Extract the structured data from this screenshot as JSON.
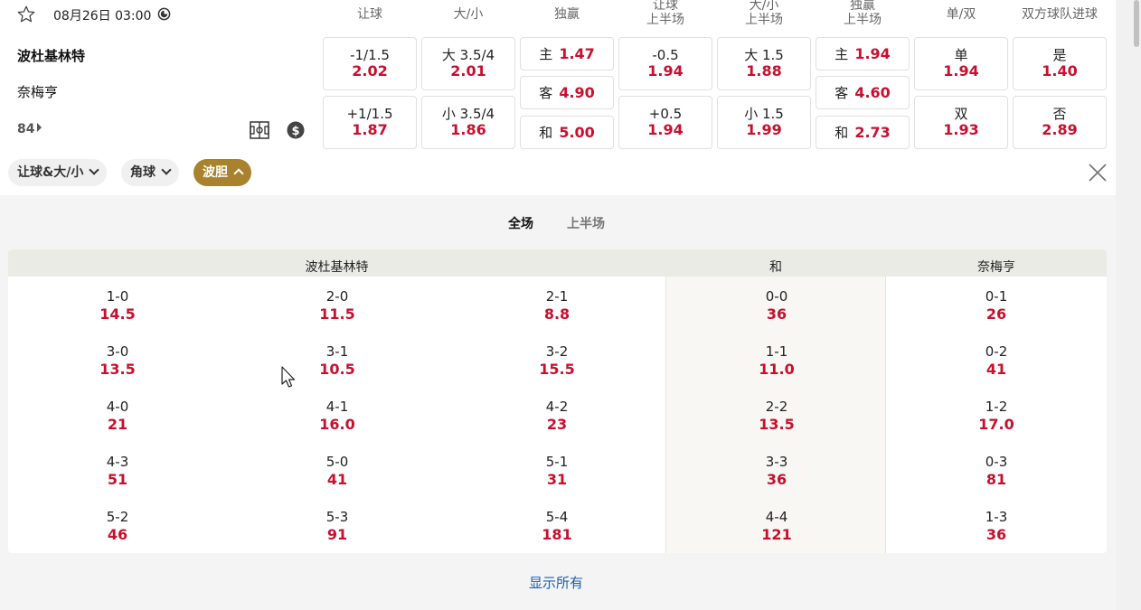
{
  "match": {
    "datetime": "08月26日 03:00",
    "home": "波杜基林特",
    "away": "奈梅亨",
    "more_markets": "84"
  },
  "headers": [
    {
      "l1": "让球",
      "l2": ""
    },
    {
      "l1": "大/小",
      "l2": ""
    },
    {
      "l1": "独赢",
      "l2": ""
    },
    {
      "l1": "让球",
      "l2": "上半场"
    },
    {
      "l1": "大/小",
      "l2": "上半场"
    },
    {
      "l1": "独赢",
      "l2": "上半场"
    },
    {
      "l1": "单/双",
      "l2": ""
    },
    {
      "l1": "双方球队进球",
      "l2": ""
    }
  ],
  "odds": {
    "handicap": [
      {
        "label": "-1/1.5",
        "odd": "2.02"
      },
      {
        "label": "+1/1.5",
        "odd": "1.87"
      }
    ],
    "over_under": [
      {
        "label": "大 3.5/4",
        "odd": "2.01"
      },
      {
        "label": "小 3.5/4",
        "odd": "1.86"
      }
    ],
    "moneyline": [
      {
        "label": "主",
        "odd": "1.47"
      },
      {
        "label": "客",
        "odd": "4.90"
      },
      {
        "label": "和",
        "odd": "5.00"
      }
    ],
    "handicap_1h": [
      {
        "label": "-0.5",
        "odd": "1.94"
      },
      {
        "label": "+0.5",
        "odd": "1.94"
      }
    ],
    "over_under_1h": [
      {
        "label": "大 1.5",
        "odd": "1.88"
      },
      {
        "label": "小 1.5",
        "odd": "1.99"
      }
    ],
    "moneyline_1h": [
      {
        "label": "主",
        "odd": "1.94"
      },
      {
        "label": "客",
        "odd": "4.60"
      },
      {
        "label": "和",
        "odd": "2.73"
      }
    ],
    "odd_even": [
      {
        "label": "单",
        "odd": "1.94"
      },
      {
        "label": "双",
        "odd": "1.93"
      }
    ],
    "btts": [
      {
        "label": "是",
        "odd": "1.40"
      },
      {
        "label": "否",
        "odd": "2.89"
      }
    ]
  },
  "filters": {
    "chip1": "让球&大/小",
    "chip2": "角球",
    "chip3": "波胆"
  },
  "panel_tabs": {
    "full": "全场",
    "half": "上半场"
  },
  "grid_headers": {
    "home": "波杜基林特",
    "draw": "和",
    "away": "奈梅亨"
  },
  "correct_score": {
    "home_c1": [
      {
        "s": "1-0",
        "o": "14.5"
      },
      {
        "s": "3-0",
        "o": "13.5"
      },
      {
        "s": "4-0",
        "o": "21"
      },
      {
        "s": "4-3",
        "o": "51"
      },
      {
        "s": "5-2",
        "o": "46"
      }
    ],
    "home_c2": [
      {
        "s": "2-0",
        "o": "11.5"
      },
      {
        "s": "3-1",
        "o": "10.5"
      },
      {
        "s": "4-1",
        "o": "16.0"
      },
      {
        "s": "5-0",
        "o": "41"
      },
      {
        "s": "5-3",
        "o": "91"
      }
    ],
    "home_c3": [
      {
        "s": "2-1",
        "o": "8.8"
      },
      {
        "s": "3-2",
        "o": "15.5"
      },
      {
        "s": "4-2",
        "o": "23"
      },
      {
        "s": "5-1",
        "o": "31"
      },
      {
        "s": "5-4",
        "o": "181"
      }
    ],
    "draw": [
      {
        "s": "0-0",
        "o": "36"
      },
      {
        "s": "1-1",
        "o": "11.0"
      },
      {
        "s": "2-2",
        "o": "13.5"
      },
      {
        "s": "3-3",
        "o": "36"
      },
      {
        "s": "4-4",
        "o": "121"
      }
    ],
    "away": [
      {
        "s": "0-1",
        "o": "26"
      },
      {
        "s": "0-2",
        "o": "41"
      },
      {
        "s": "1-2",
        "o": "17.0"
      },
      {
        "s": "0-3",
        "o": "81"
      },
      {
        "s": "1-3",
        "o": "36"
      }
    ]
  },
  "show_all": "显示所有",
  "colors": {
    "odds_red": "#c8102e",
    "accent_gold": "#a8822c",
    "link_blue": "#1a5fb4"
  }
}
